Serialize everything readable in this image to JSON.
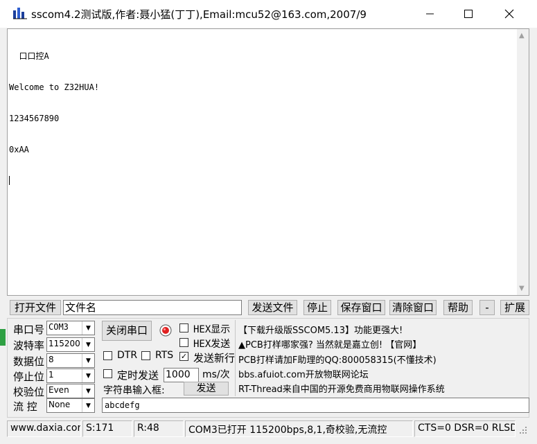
{
  "window": {
    "title": "sscom4.2测试版,作者:聂小猛(丁丁),Email:mcu52@163.com,2007/9"
  },
  "receive": {
    "lines": [
      "  口口控A",
      "Welcome to Z32HUA!",
      "1234567890",
      "0xAA"
    ]
  },
  "file_bar": {
    "open_file": "打开文件",
    "file_name": "文件名",
    "send_file": "发送文件",
    "stop": "停止",
    "save_window": "保存窗口",
    "clear_window": "清除窗口",
    "help": "帮助",
    "minus": "-",
    "expand": "扩展"
  },
  "serial": {
    "port_label": "串口号",
    "port_value": "COM3",
    "baud_label": "波特率",
    "baud_value": "115200",
    "data_label": "数据位",
    "data_value": "8",
    "stop_label": "停止位",
    "stop_value": "1",
    "parity_label": "校验位",
    "parity_value": "Even",
    "flow_label": "流 控",
    "flow_value": "None"
  },
  "controls": {
    "close_port": "关闭串口",
    "hex_display": "HEX显示",
    "hex_send": "HEX发送",
    "dtr": "DTR",
    "rts": "RTS",
    "send_newline": "发送新行",
    "timed_send": "定时发送",
    "interval": "1000",
    "unit": "ms/次",
    "input_label": "字符串输入框:",
    "send": "发送",
    "input_value": "abcdefg"
  },
  "ads": [
    "【下载升级版SSCOM5.13】功能更强大!",
    "▲PCB打样哪家强? 当然就是嘉立创! 【官网】",
    "PCB打样请加F助理的QQ:800058315(不懂技术)",
    "bbs.afuiot.com开放物联网论坛",
    "RT-Thread来自中国的开源免费商用物联网操作系统"
  ],
  "status": {
    "website": "www.daxia.cor",
    "sent": "S:171",
    "received": "R:48",
    "port_status": "COM3已打开  115200bps,8,1,奇校验,无流控",
    "signals": "CTS=0 DSR=0 RLSD"
  },
  "colors": {
    "receive_bg": "#ffffff",
    "window_bg": "#f0f0f0"
  }
}
